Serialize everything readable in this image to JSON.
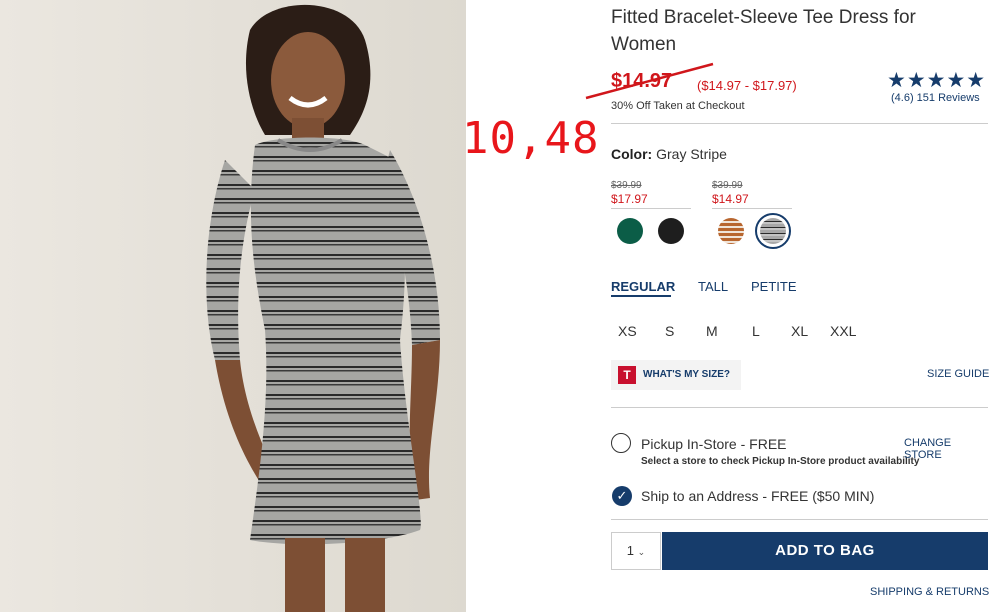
{
  "product": {
    "title": "Fitted Bracelet-Sleeve Tee Dress for Women",
    "price": "$14.97",
    "price_range": "($14.97 - $17.97)",
    "promo": "30% Off Taken at Checkout",
    "rating": {
      "stars": "★★★★★",
      "text": "(4.6) 151 Reviews",
      "value": 4.6
    },
    "annotation": "10,48"
  },
  "color": {
    "label": "Color:",
    "value": "Gray Stripe",
    "groups": [
      {
        "old_price": "$39.99",
        "new_price": "$17.97",
        "swatches": [
          "#0b5d47",
          "#1e1e1e"
        ]
      },
      {
        "old_price": "$39.99",
        "new_price": "$14.97",
        "swatches": [
          "#b8662f",
          "#a8a8a8"
        ]
      }
    ]
  },
  "fit_tabs": [
    "REGULAR",
    "TALL",
    "PETITE"
  ],
  "sizes": [
    "XS",
    "S",
    "M",
    "L",
    "XL",
    "XXL"
  ],
  "whats_my_size": {
    "icon": "T",
    "label": "WHAT'S MY SIZE?"
  },
  "size_guide": "SIZE GUIDE",
  "pickup": {
    "label": "Pickup In-Store - FREE",
    "sub": "Select a store to check Pickup In-Store product availability",
    "change_store": "CHANGE STORE"
  },
  "ship": {
    "label": "Ship to an Address - FREE ($50 MIN)"
  },
  "quantity": "1",
  "add_to_bag": "ADD TO BAG",
  "shipping_returns": "SHIPPING & RETURNS",
  "colors": {
    "navy": "#163c6b",
    "sale_red": "#d0161b"
  }
}
